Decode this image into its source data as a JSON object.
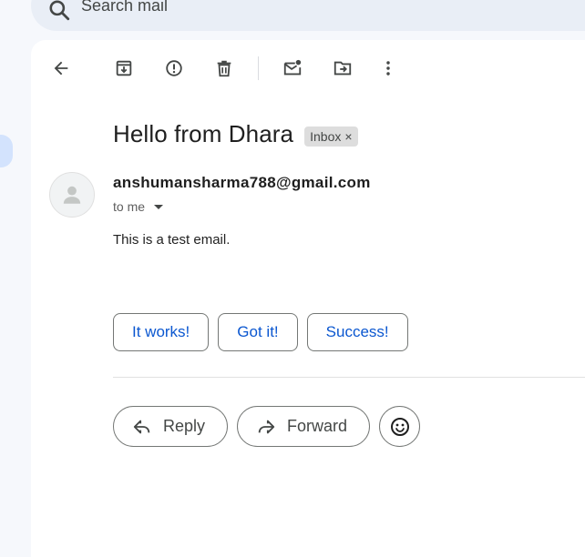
{
  "search": {
    "placeholder": "Search mail",
    "icon": "search-icon"
  },
  "toolbar": {
    "items": [
      {
        "name": "back-button",
        "icon": "arrow-back-icon"
      },
      {
        "name": "archive-button",
        "icon": "archive-icon"
      },
      {
        "name": "report-spam-button",
        "icon": "report-spam-icon"
      },
      {
        "name": "delete-button",
        "icon": "trash-icon"
      },
      {
        "name": "mark-unread-button",
        "icon": "mark-unread-icon"
      },
      {
        "name": "move-to-button",
        "icon": "move-to-folder-icon"
      },
      {
        "name": "more-options-button",
        "icon": "more-vert-icon"
      }
    ]
  },
  "message": {
    "subject": "Hello from Dhara",
    "label": "Inbox",
    "label_close": "×",
    "sender": "anshumansharma788@gmail.com",
    "recipient": "to me",
    "body": "This is a test email."
  },
  "smart_replies": [
    "It works!",
    "Got it!",
    "Success!"
  ],
  "actions": {
    "reply": "Reply",
    "forward": "Forward"
  },
  "colors": {
    "accent": "#0b57d0",
    "background": "#f6f8fc",
    "search_bg": "#e9eef6",
    "chip_bg": "#dddddd"
  }
}
